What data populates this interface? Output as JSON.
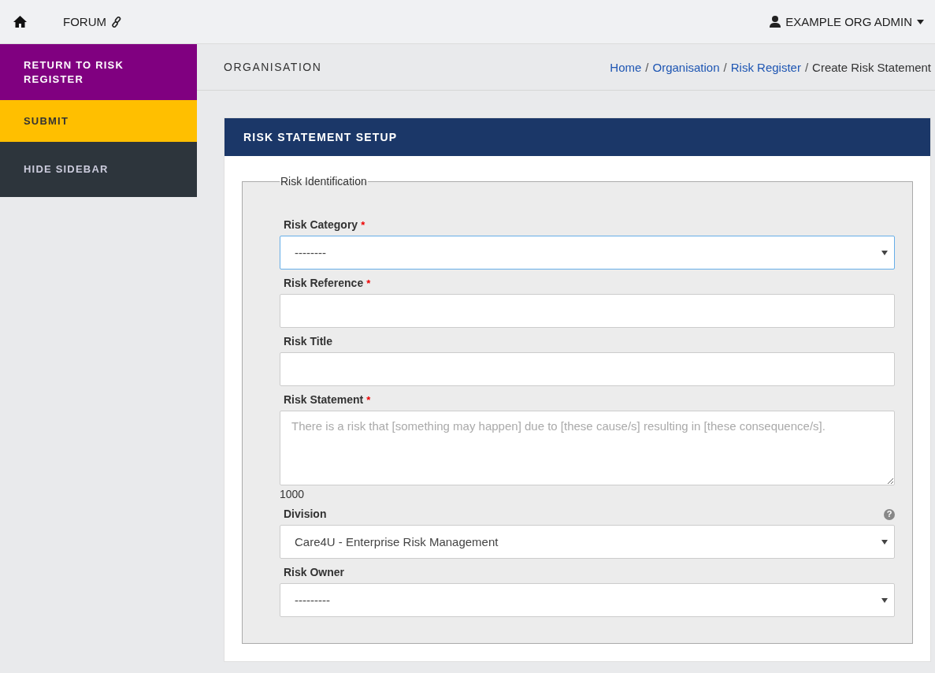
{
  "topbar": {
    "forum": "FORUM",
    "user": "EXAMPLE ORG ADMIN"
  },
  "sidebar": {
    "items": [
      {
        "label": "RETURN TO RISK REGISTER",
        "color": "#800080"
      },
      {
        "label": "SUBMIT",
        "color": "#ffbf00"
      },
      {
        "label": "HIDE SIDEBAR",
        "color": "#2d353c"
      }
    ]
  },
  "page_header": {
    "title": "ORGANISATION",
    "separator": "/",
    "breadcrumb": [
      {
        "label": "Home",
        "link": true
      },
      {
        "label": "Organisation",
        "link": true
      },
      {
        "label": "Risk Register",
        "link": true
      },
      {
        "label": "Create Risk Statement",
        "link": false
      }
    ]
  },
  "panel": {
    "title": "RISK STATEMENT SETUP",
    "fieldset": {
      "legend": "Risk Identification",
      "fields": [
        {
          "kind": "select",
          "label": "Risk Category",
          "required_mark": "*",
          "value": "--------",
          "focused": true
        },
        {
          "kind": "text",
          "label": "Risk Reference",
          "required_mark": "*",
          "focused": false
        },
        {
          "kind": "text",
          "label": "Risk Title",
          "focused": false
        },
        {
          "kind": "textarea",
          "label": "Risk Statement",
          "required_mark": "*",
          "placeholder": "There is a risk that [something may happen] due to [these cause/s] resulting in [these consequence/s].",
          "counter": "1000",
          "focused": false
        },
        {
          "kind": "select",
          "label": "Division",
          "value": "Care4U - Enterprise Risk Management",
          "help": "?",
          "focused": false
        },
        {
          "kind": "select",
          "label": "Risk Owner",
          "value": "---------",
          "focused": false
        }
      ]
    }
  }
}
